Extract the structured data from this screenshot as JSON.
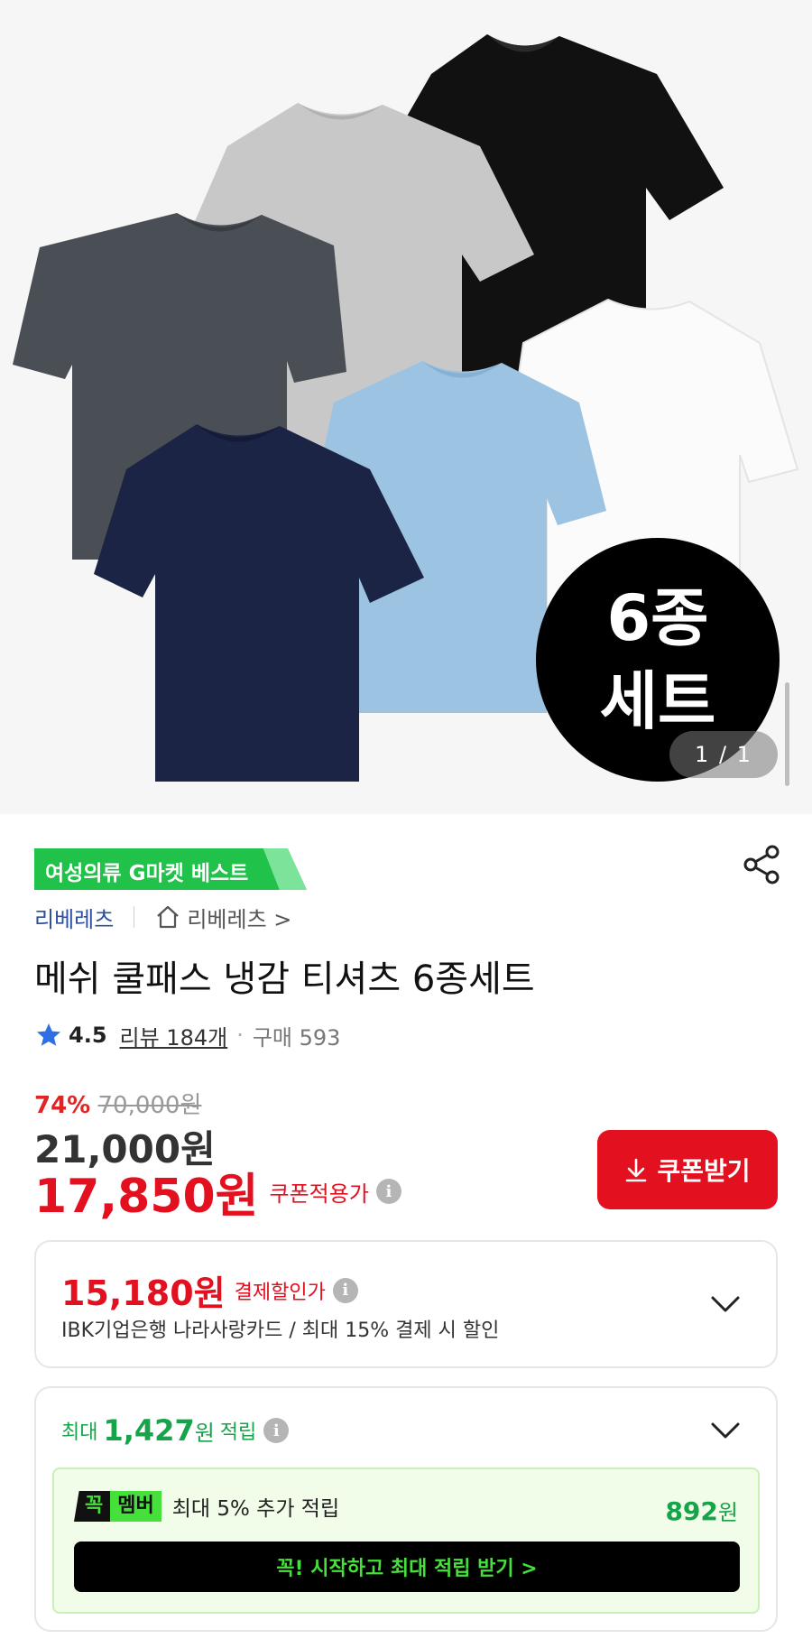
{
  "hero": {
    "badge_line1": "6종",
    "badge_line2": "세트",
    "pager": "1 / 1"
  },
  "product": {
    "best_tag": "여성의류 G마켓 베스트",
    "brand": "리베레츠",
    "store": "리베레츠",
    "store_chevron": ">",
    "title": "메쉬 쿨패스 냉감 티셔츠 6종세트",
    "rating": "4.5",
    "review_label": "리뷰 184개",
    "purchase_label": "구매 593",
    "discount_rate": "74%",
    "original_price": "70,000",
    "original_price_unit": "원",
    "sale_price": "21,000원",
    "coupon_price": "17,850원",
    "coupon_price_label": "쿠폰적용가",
    "coupon_button": "쿠폰받기"
  },
  "card_benefit": {
    "price": "15,180원",
    "label": "결제할인가",
    "description": "IBK기업은행 나라사랑카드 / 최대 15% 결제 시 할인"
  },
  "reward": {
    "prefix": "최대",
    "amount": "1,427",
    "unit": "원",
    "suffix": "적립",
    "member_badge_a": "꼭",
    "member_badge_b": "멤버",
    "member_text": "최대 5% 추가 적립",
    "member_amount": "892",
    "member_unit": "원",
    "member_button": "꼭! 시작하고 최대 적립 받기 >"
  },
  "colors": {
    "accent_red": "#e3101f",
    "reward_green": "#16a34a",
    "tag_green": "#21c24a",
    "member_green": "#45e03a"
  },
  "icons": [
    "share-icon",
    "home-icon",
    "star-icon",
    "info-icon",
    "download-icon",
    "chevron-down-icon"
  ]
}
